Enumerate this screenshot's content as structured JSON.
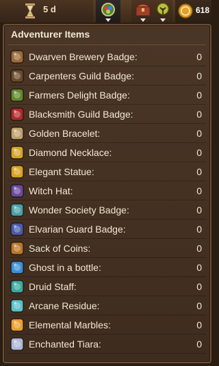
{
  "topbar": {
    "days": "5 d",
    "coins": "618",
    "icons": [
      "hourglass-icon",
      "badges-icon",
      "chest-icon",
      "tree-icon",
      "coin-icon"
    ]
  },
  "panel": {
    "title": "Adventurer Items",
    "items": [
      {
        "label": "Dwarven Brewery Badge:",
        "value": "0",
        "icon": "dwarven-brewery-badge-icon",
        "color": "#9a6a3a"
      },
      {
        "label": "Carpenters Guild Badge:",
        "value": "0",
        "icon": "carpenters-guild-badge-icon",
        "color": "#6a4a2a"
      },
      {
        "label": "Farmers Delight Badge:",
        "value": "0",
        "icon": "farmers-delight-badge-icon",
        "color": "#5f8a2a"
      },
      {
        "label": "Blacksmith Guild Badge:",
        "value": "0",
        "icon": "blacksmith-guild-badge-icon",
        "color": "#b02a2a"
      },
      {
        "label": "Golden Bracelet:",
        "value": "0",
        "icon": "golden-bracelet-icon",
        "color": "#c0a070"
      },
      {
        "label": "Diamond Necklace:",
        "value": "0",
        "icon": "diamond-necklace-icon",
        "color": "#d4a52a"
      },
      {
        "label": "Elegant Statue:",
        "value": "0",
        "icon": "elegant-statue-icon",
        "color": "#d9a320"
      },
      {
        "label": "Witch Hat:",
        "value": "0",
        "icon": "witch-hat-icon",
        "color": "#6a4aa0"
      },
      {
        "label": "Wonder Society Badge:",
        "value": "0",
        "icon": "wonder-society-badge-icon",
        "color": "#4aa0a8"
      },
      {
        "label": "Elvarian Guard Badge:",
        "value": "0",
        "icon": "elvarian-guard-badge-icon",
        "color": "#4a5aa8"
      },
      {
        "label": "Sack of Coins:",
        "value": "0",
        "icon": "sack-of-coins-icon",
        "color": "#b8782a"
      },
      {
        "label": "Ghost in a bottle:",
        "value": "0",
        "icon": "ghost-in-a-bottle-icon",
        "color": "#3a8fd8"
      },
      {
        "label": "Druid Staff:",
        "value": "0",
        "icon": "druid-staff-icon",
        "color": "#3aa8a0"
      },
      {
        "label": "Arcane Residue:",
        "value": "0",
        "icon": "arcane-residue-icon",
        "color": "#5ac0c8"
      },
      {
        "label": "Elemental Marbles:",
        "value": "0",
        "icon": "elemental-marbles-icon",
        "color": "#e8a030"
      },
      {
        "label": "Enchanted Tiara:",
        "value": "0",
        "icon": "enchanted-tiara-icon",
        "color": "#b0b8d8"
      }
    ]
  }
}
